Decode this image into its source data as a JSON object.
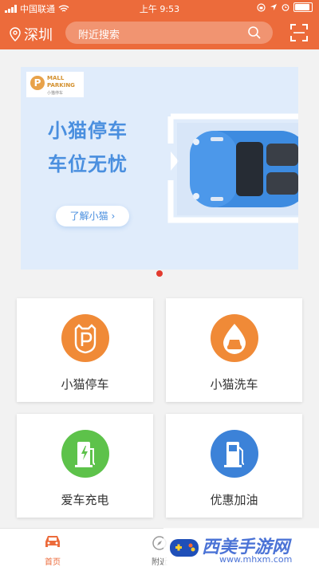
{
  "status_bar": {
    "carrier": "中国联通",
    "time": "上午 9:53"
  },
  "header": {
    "city": "深圳",
    "search_placeholder": "附近搜索"
  },
  "banner": {
    "logo_line1": "MALL",
    "logo_line2": "PARKING",
    "logo_sub": "小猫停车",
    "title_line1": "小猫停车",
    "title_line2": "车位无忧",
    "button_label": "了解小猫"
  },
  "services": [
    {
      "label": "小猫停车",
      "color": "#f08a37"
    },
    {
      "label": "小猫洗车",
      "color": "#f08a37"
    },
    {
      "label": "爱车充电",
      "color": "#5dc24a"
    },
    {
      "label": "优惠加油",
      "color": "#3c82d8"
    }
  ],
  "tabs": [
    {
      "label": "首页",
      "active": true
    },
    {
      "label": "附近",
      "active": false
    }
  ],
  "watermark": {
    "title": "西美手游网",
    "url": "www.mhxm.com"
  },
  "colors": {
    "brand": "#ec6b3b",
    "banner_text": "#4a8fdf",
    "indicator": "#e23b2e"
  }
}
